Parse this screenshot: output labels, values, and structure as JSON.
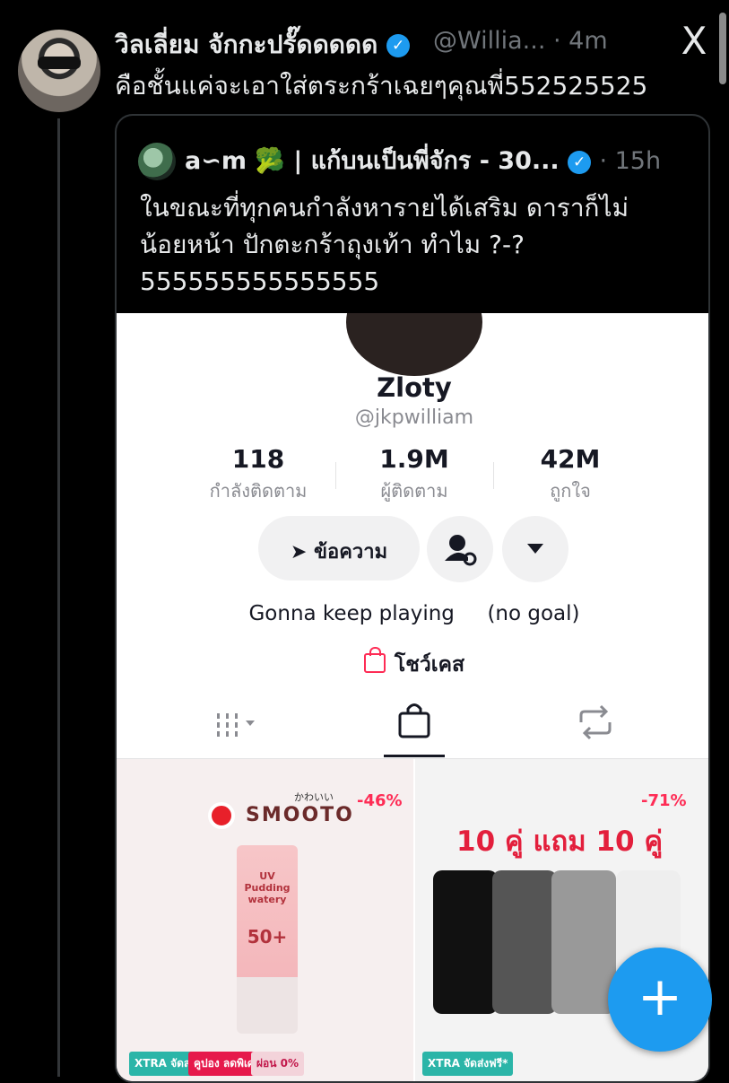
{
  "tweet": {
    "author_name": "วิลเลี่ยม จักกะปรั๊ดดดดด",
    "handle_time": "@Willia... · 4m",
    "text": "คือชั้นแค่จะเอาใส่ตระกร้าเฉยๆคุณพี่552525525",
    "close_glyph": "X"
  },
  "quote": {
    "author_name": "a∽m 🥦 | แก้บนเป็นพี่จักร - 30...",
    "time": "· 15h",
    "text_lines": [
      "ในขณะที่ทุกคนกำลังหารายได้เสริม ดาราก็ไม่",
      "น้อยหน้า ปักตะกร้าถุงเท้า ทำไม ?-?",
      "555555555555555"
    ]
  },
  "profile": {
    "display_name": "Zloty",
    "handle": "@jkpwilliam",
    "stats": [
      {
        "value": "118",
        "label": "กำลังติดตาม"
      },
      {
        "value": "1.9M",
        "label": "ผู้ติดตาม"
      },
      {
        "value": "42M",
        "label": "ถูกใจ"
      }
    ],
    "message_button": "ข้อความ",
    "bio": "Gonna keep playing     (no goal)",
    "showcase_label": "โชว์เคส"
  },
  "products": [
    {
      "discount": "-46%",
      "brand": "SMOOTO",
      "brand_jp": "かわいい",
      "tube_text": "UV Pudding watery",
      "tube_sub": "50+",
      "badges": [
        "XTRA จัดส่งฟรี*",
        "คูปอง ลดพิเศษ",
        "ผ่อน 0%"
      ]
    },
    {
      "discount": "-71%",
      "title": "10 คู่ แถม 10 คู่",
      "badges": [
        "XTRA จัดส่งฟรี*"
      ]
    }
  ],
  "colors": {
    "accent": "#1d9bf0",
    "tiktok_red": "#fe2c55",
    "background": "#000000"
  }
}
